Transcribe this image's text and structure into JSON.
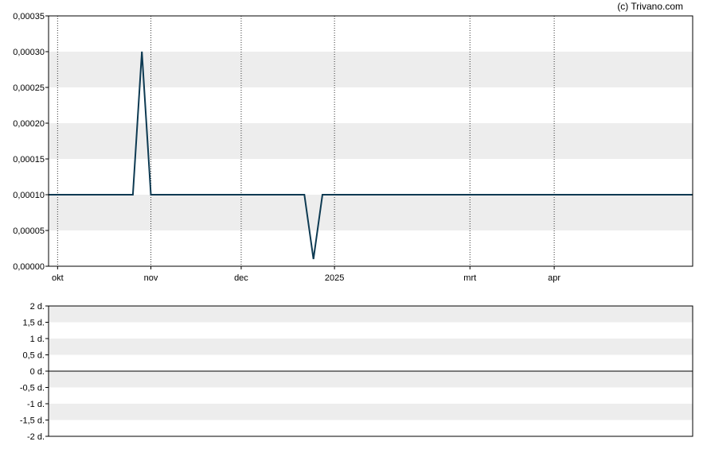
{
  "copyright": "(c) Trivano.com",
  "chart_data": [
    {
      "type": "line",
      "title": "",
      "xlabel": "",
      "ylabel": "",
      "x_ticks": [
        {
          "label": "okt",
          "date": "2024-10-01"
        },
        {
          "label": "nov",
          "date": "2024-11-01"
        },
        {
          "label": "dec",
          "date": "2024-12-01"
        },
        {
          "label": "2025",
          "date": "2025-01-01"
        },
        {
          "label": "mrt",
          "date": "2025-02-15"
        },
        {
          "label": "apr",
          "date": "2025-03-15"
        }
      ],
      "y_ticks": [
        "0,00000",
        "0,00005",
        "0,00010",
        "0,00015",
        "0,00020",
        "0,00025",
        "0,00030",
        "0,00035"
      ],
      "ylim": [
        0,
        0.00035
      ],
      "xlim": [
        "2024-09-28",
        "2025-04-30"
      ],
      "grid": "horizontal bands, vertical dotted lines",
      "line_color": "#0d3a52",
      "band_color": "#ededed",
      "series": [
        {
          "x": [
            "2024-09-28",
            "2024-10-26",
            "2024-10-29",
            "2024-11-01",
            "2024-12-22",
            "2024-12-25",
            "2024-12-28",
            "2025-04-30"
          ],
          "y": [
            0.0001,
            0.0001,
            0.0003,
            0.0001,
            0.0001,
            1e-05,
            0.0001,
            0.0001
          ]
        }
      ]
    },
    {
      "type": "line",
      "title": "",
      "y_ticks": [
        "2 d.",
        "1,5 d.",
        "1 d.",
        "0,5 d.",
        "0 d.",
        "-0,5 d.",
        "-1 d.",
        "-1,5 d.",
        "-2 d."
      ],
      "ylim": [
        -2,
        2
      ],
      "baseline": 0,
      "series": []
    }
  ]
}
